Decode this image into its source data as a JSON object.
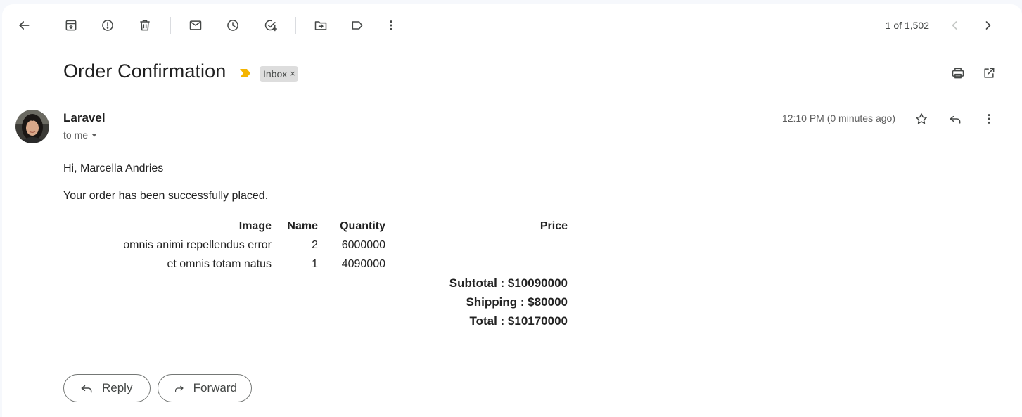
{
  "toolbar": {
    "back_icon": "arrow-left-icon",
    "archive_icon": "archive-icon",
    "spam_icon": "report-spam-icon",
    "delete_icon": "trash-icon",
    "mark_unread_icon": "mail-icon",
    "snooze_icon": "clock-icon",
    "add_task_icon": "add-task-icon",
    "move_to_icon": "move-folder-icon",
    "labels_icon": "label-icon",
    "more_icon": "more-vertical-icon",
    "pager": "1 of 1,502"
  },
  "email": {
    "subject": "Order Confirmation",
    "label_chip": "Inbox",
    "label_chip_remove": "×",
    "importance_color": "#f4b400",
    "sender": "Laravel",
    "recipient": "to me",
    "time": "12:10 PM (0 minutes ago)",
    "greeting": "Hi, Marcella Andries",
    "message": "Your order has been successfully placed."
  },
  "order_table": {
    "headers": {
      "image": "Image",
      "name": "Name",
      "quantity": "Quantity",
      "price": "Price"
    },
    "rows": [
      {
        "image": "omnis animi repellendus error",
        "name": "2",
        "quantity": "6000000",
        "price": ""
      },
      {
        "image": "et omnis totam natus",
        "name": "1",
        "quantity": "4090000",
        "price": ""
      }
    ],
    "subtotal": "Subtotal : $10090000",
    "shipping": "Shipping : $80000",
    "total": "Total : $10170000"
  },
  "actions": {
    "reply": "Reply",
    "forward": "Forward"
  }
}
